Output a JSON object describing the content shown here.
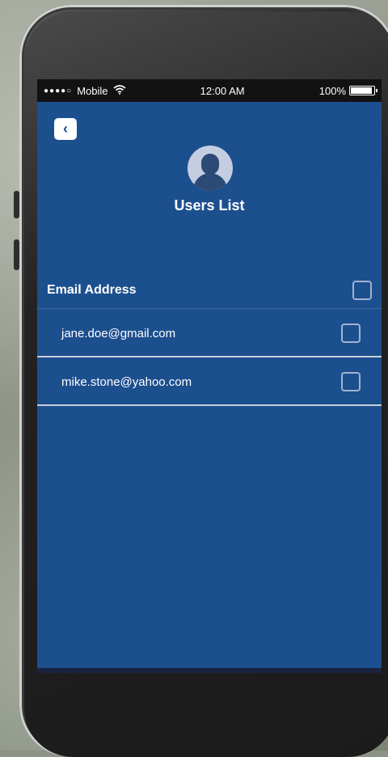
{
  "status_bar": {
    "signal": "●●●●○",
    "carrier": "Mobile",
    "wifi_icon": "wifi-icon",
    "time": "12:00 AM",
    "battery_percent": "100%",
    "battery_level": 1.0
  },
  "header": {
    "back_icon": "chevron-left-icon",
    "back_glyph": "‹",
    "avatar_icon": "user-avatar-icon",
    "title": "Users List"
  },
  "list": {
    "column_label": "Email Address",
    "items": [
      {
        "email": "jane.doe@gmail.com",
        "checked": false
      },
      {
        "email": "mike.stone@yahoo.com",
        "checked": false
      }
    ]
  },
  "colors": {
    "screen_bg": "#1c4f8e",
    "text": "#ffffff"
  }
}
